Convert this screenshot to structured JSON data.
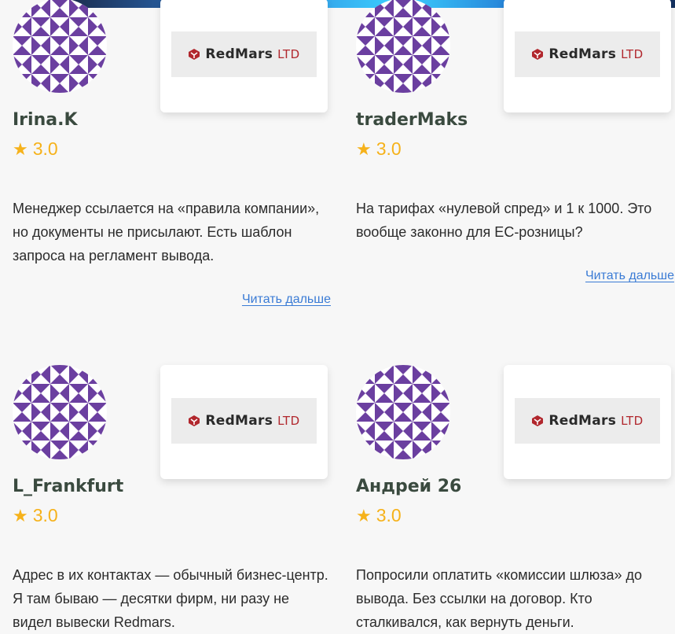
{
  "reviews": [
    {
      "author": "Irina.K",
      "rating": "3.0",
      "text": "Менеджер ссылается на «правила компании», но документы не присылают. Есть шаблон запроса на регламент вывода.",
      "more": "Читать дальше",
      "logo": {
        "name": "RedMars",
        "suffix": "LTD"
      }
    },
    {
      "author": "traderMaks",
      "rating": "3.0",
      "text": "На тарифах «нулевой спред» и 1 к 1000. Это вообще законно для ЕС-розницы?",
      "more": "Читать дальше",
      "logo": {
        "name": "RedMars",
        "suffix": "LTD"
      }
    },
    {
      "author": "L_Frankfurt",
      "rating": "3.0",
      "text": "Адрес в их контактах — обычный бизнес-центр. Я там бываю — десятки фирм, ни разу не видел вывески Redmars.",
      "more": "",
      "logo": {
        "name": "RedMars",
        "suffix": "LTD"
      }
    },
    {
      "author": "Андрей 26",
      "rating": "3.0",
      "text": "Попросили оплатить «комиссии шлюза» до вывода. Без ссылки на договор. Кто сталкивался, как вернуть деньги.",
      "more": "",
      "logo": {
        "name": "RedMars",
        "suffix": "LTD"
      }
    }
  ],
  "colors": {
    "avatar": "#6b3fa0",
    "star": "#f6b21b",
    "link": "#3a7bd5",
    "brand": "#b1272d"
  },
  "icons": {
    "avatar": "identicon-icon",
    "rating": "star-icon",
    "logo": "redmars-logo-icon"
  }
}
